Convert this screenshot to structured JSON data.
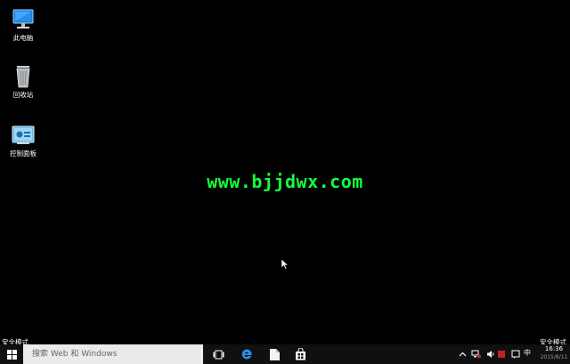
{
  "desktop": {
    "icons": [
      {
        "label": "此电脑",
        "icon": "computer-icon"
      },
      {
        "label": "回收站",
        "icon": "recycle-bin-icon"
      },
      {
        "label": "控制面板",
        "icon": "control-panel-icon"
      }
    ],
    "watermark": "www.bjjdwx.com",
    "safe_mode_left": "安全模式",
    "safe_mode_right": "安全模式"
  },
  "taskbar": {
    "start_icon": "windows-logo-icon",
    "search_placeholder": "搜索 Web 和 Windows",
    "pinned": [
      {
        "icon": "task-view-icon"
      },
      {
        "icon": "edge-browser-icon"
      },
      {
        "icon": "file-explorer-icon"
      },
      {
        "icon": "store-icon"
      }
    ],
    "tray": {
      "ime": "中",
      "time": "16:36",
      "date": "2015/8/11"
    }
  },
  "colors": {
    "desktop_bg": "#000000",
    "taskbar_bg": "#101010",
    "watermark": "#16ff3a",
    "search_bg": "#ebebeb",
    "accent_blue": "#2b8ee8"
  }
}
